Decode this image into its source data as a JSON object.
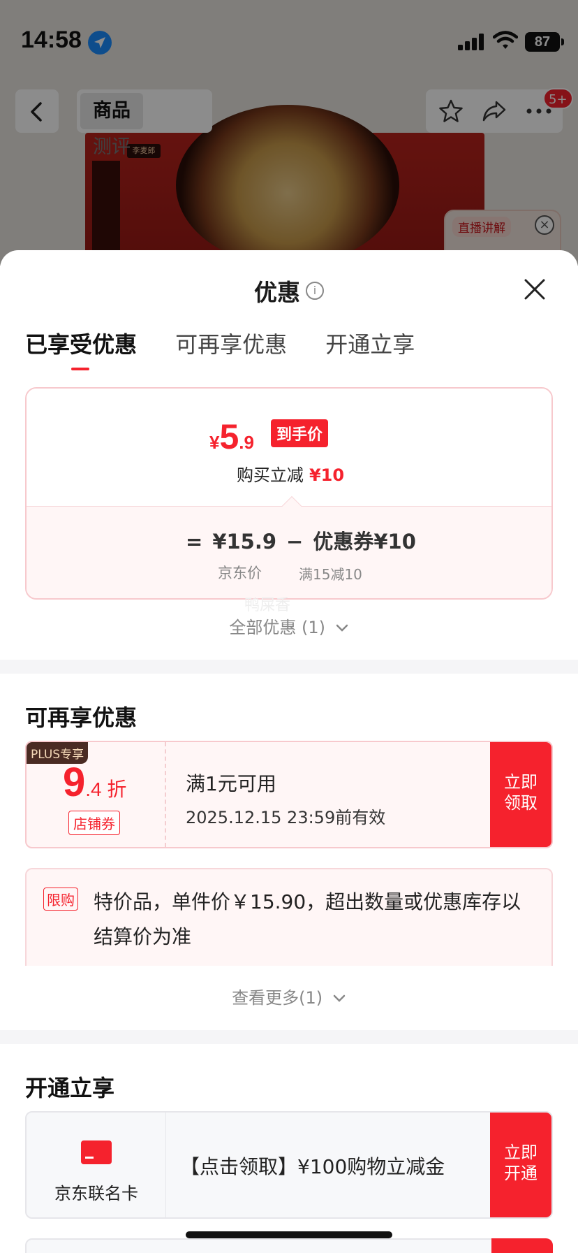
{
  "status_bar": {
    "time": "14:58",
    "battery": "87"
  },
  "nav": {
    "tabs": [
      "商品",
      "测评"
    ],
    "badge": "5+"
  },
  "background": {
    "live_label": "直播讲解",
    "product_tag": "李麦郎"
  },
  "sheet": {
    "title": "优惠",
    "info_icon": "i",
    "tabs": [
      "已享受优惠",
      "可再享优惠",
      "开通立享"
    ],
    "enjoyed": {
      "currency": "¥",
      "price_int": "5",
      "price_dec": ".9",
      "price_tag": "到手价",
      "reduce_label": "购买立减",
      "reduce_value": "¥10",
      "eq_sign": "=",
      "original_price": "¥15.9",
      "minus": "−",
      "coupon_label": "优惠券¥10",
      "original_price_label": "京东价",
      "coupon_condition": "满15减10"
    },
    "watermark": "鸭屎香",
    "all_promo": "全部优惠 (1)",
    "more_section": {
      "title": "可再享优惠",
      "coupon": {
        "plus_tag": "PLUS专享",
        "discount_big": "9",
        "discount_small": ".4 折",
        "type": "店铺券",
        "condition": "满1元可用",
        "expiry": "2025.12.15 23:59前有效",
        "button_line1": "立即",
        "button_line2": "领取"
      },
      "limit": {
        "tag": "限购",
        "text": "特价品，单件价￥15.90，超出数量或优惠库存以结算价为准"
      },
      "see_more": "查看更多(1)"
    },
    "open_section": {
      "title": "开通立享",
      "card": {
        "name": "京东联名卡",
        "desc": "【点击领取】¥100购物立减金",
        "button_line1": "立即",
        "button_line2": "开通"
      }
    }
  }
}
